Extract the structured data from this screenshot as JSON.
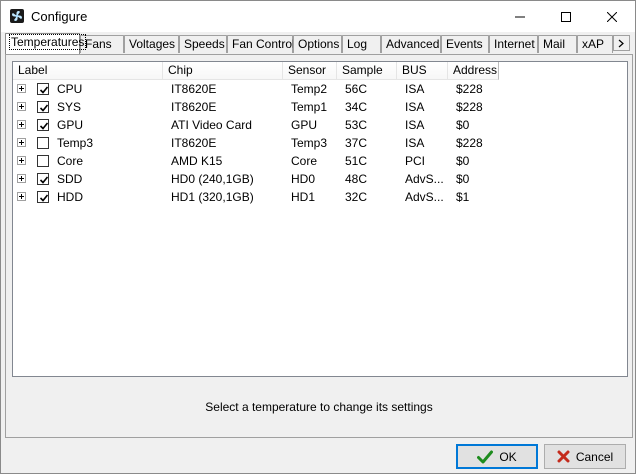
{
  "window": {
    "title": "Configure"
  },
  "tabs": [
    {
      "label": "Temperatures",
      "active": true
    },
    {
      "label": "Fans"
    },
    {
      "label": "Voltages"
    },
    {
      "label": "Speeds"
    },
    {
      "label": "Fan Control"
    },
    {
      "label": "Options"
    },
    {
      "label": "Log"
    },
    {
      "label": "Advanced"
    },
    {
      "label": "Events"
    },
    {
      "label": "Internet"
    },
    {
      "label": "Mail"
    },
    {
      "label": "xAP"
    }
  ],
  "table": {
    "columns": [
      "Label",
      "Chip",
      "Sensor",
      "Sample",
      "BUS",
      "Address"
    ],
    "rows": [
      {
        "checked": true,
        "label": "CPU",
        "chip": "IT8620E",
        "sensor": "Temp2",
        "sample": "56C",
        "bus": "ISA",
        "address": "$228"
      },
      {
        "checked": true,
        "label": "SYS",
        "chip": "IT8620E",
        "sensor": "Temp1",
        "sample": "34C",
        "bus": "ISA",
        "address": "$228"
      },
      {
        "checked": true,
        "label": "GPU",
        "chip": "ATI Video Card",
        "sensor": "GPU",
        "sample": "53C",
        "bus": "ISA",
        "address": "$0"
      },
      {
        "checked": false,
        "label": "Temp3",
        "chip": "IT8620E",
        "sensor": "Temp3",
        "sample": "37C",
        "bus": "ISA",
        "address": "$228"
      },
      {
        "checked": false,
        "label": "Core",
        "chip": "AMD K15",
        "sensor": "Core",
        "sample": "51C",
        "bus": "PCI",
        "address": "$0"
      },
      {
        "checked": true,
        "label": "SDD",
        "chip": "HD0 (240,1GB)",
        "sensor": "HD0",
        "sample": "48C",
        "bus": "AdvS...",
        "address": "$0"
      },
      {
        "checked": true,
        "label": "HDD",
        "chip": "HD1 (320,1GB)",
        "sensor": "HD1",
        "sample": "32C",
        "bus": "AdvS...",
        "address": "$1"
      }
    ]
  },
  "status": "Select a temperature to change its settings",
  "buttons": {
    "ok": "OK",
    "cancel": "Cancel"
  },
  "icons": {
    "app": "fan-icon",
    "minimize": "minimize-icon",
    "maximize": "maximize-icon",
    "close": "close-icon",
    "ok": "checkmark-icon",
    "cancel": "red-x-icon",
    "expander": "plus-expander-icon"
  },
  "colors": {
    "accent": "#0078d7",
    "ok_check": "#1e8c1e",
    "cancel_x": "#c42b1c"
  }
}
